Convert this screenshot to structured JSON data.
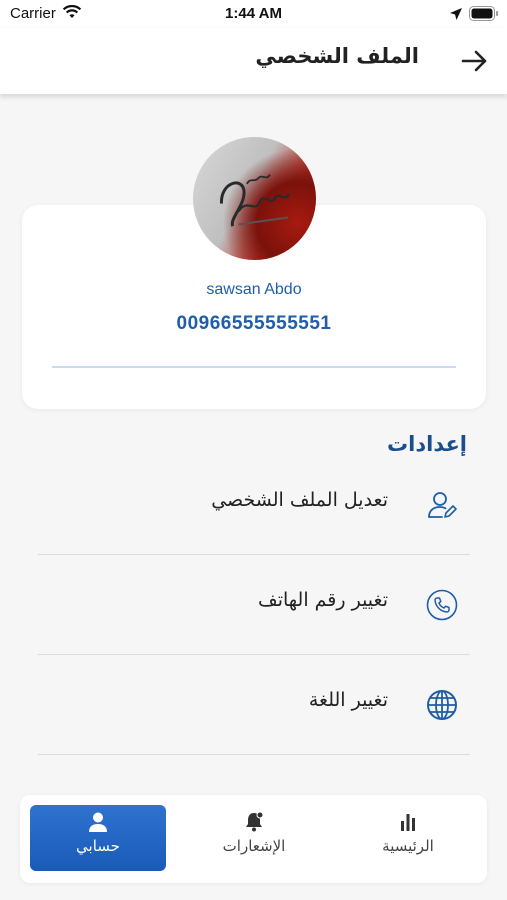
{
  "status_bar": {
    "carrier": "Carrier",
    "time": "1:44 AM"
  },
  "header": {
    "title": "الملف الشخصي"
  },
  "profile": {
    "name": "sawsan Abdo",
    "phone": "00966555555551"
  },
  "settings": {
    "title": "إعدادات",
    "items": [
      {
        "label": "تعديل الملف الشخصي",
        "icon": "user-edit-icon"
      },
      {
        "label": "تغيير رقم الهاتف",
        "icon": "phone-icon"
      },
      {
        "label": "تغيير اللغة",
        "icon": "globe-icon"
      }
    ]
  },
  "bottom_nav": {
    "items": [
      {
        "label": "حسابي",
        "icon": "user-icon",
        "active": true
      },
      {
        "label": "الإشعارات",
        "icon": "bell-icon",
        "active": false
      },
      {
        "label": "الرئيسية",
        "icon": "bar-chart-icon",
        "active": false
      }
    ]
  },
  "colors": {
    "accent": "#1f5ea8",
    "nav_active": "#1a5bb8",
    "divider": "#c9dcf0"
  }
}
